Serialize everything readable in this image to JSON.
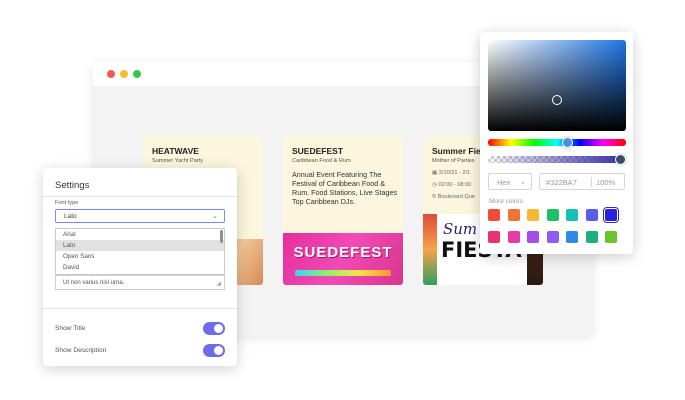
{
  "cards": [
    {
      "title": "HEATWAVE",
      "subtitle": "Summer Yacht Party"
    },
    {
      "title": "SUEDEFEST",
      "subtitle": "Caribbean Food & Rum",
      "description": "Annual Event Featuring The Festival of Caribbean Food & Rum. Food Stations, Live Stages Top Caribbean DJs.",
      "image_text": "SUEDEFEST"
    },
    {
      "title": "Summer Fiest",
      "subtitle": "Mother of Parties",
      "date": "2/10/21 - 2/1",
      "time": "02:00 - 08:00",
      "location": "Boulevard Que",
      "image_text_top": "Sum",
      "image_text_main": "FIESTA"
    }
  ],
  "settings": {
    "title": "Settings",
    "font_type_label": "Font type",
    "font_selected": "Lato",
    "font_options": [
      "Arial",
      "Lato",
      "Open Sans",
      "David"
    ],
    "font_options_selected_index": 1,
    "text_value": "Ut non varius nisl urna.",
    "toggles": [
      {
        "label": "Show Title",
        "on": true
      },
      {
        "label": "Show Description",
        "on": true
      }
    ]
  },
  "color_picker": {
    "format": "Hex",
    "hex_value": "#322BA7",
    "alpha": "100%",
    "more_colors_label": "More colors",
    "swatches": [
      "#f04c3c",
      "#f27433",
      "#f7b731",
      "#20bf6b",
      "#17c0b6",
      "#5a5ee6",
      "#2a1fe8",
      "#e8336f",
      "#e23ca7",
      "#a34ee6",
      "#8f5bf0",
      "#2d8ae8",
      "#1eae80",
      "#6cc330"
    ],
    "active_swatch_index": 6
  }
}
